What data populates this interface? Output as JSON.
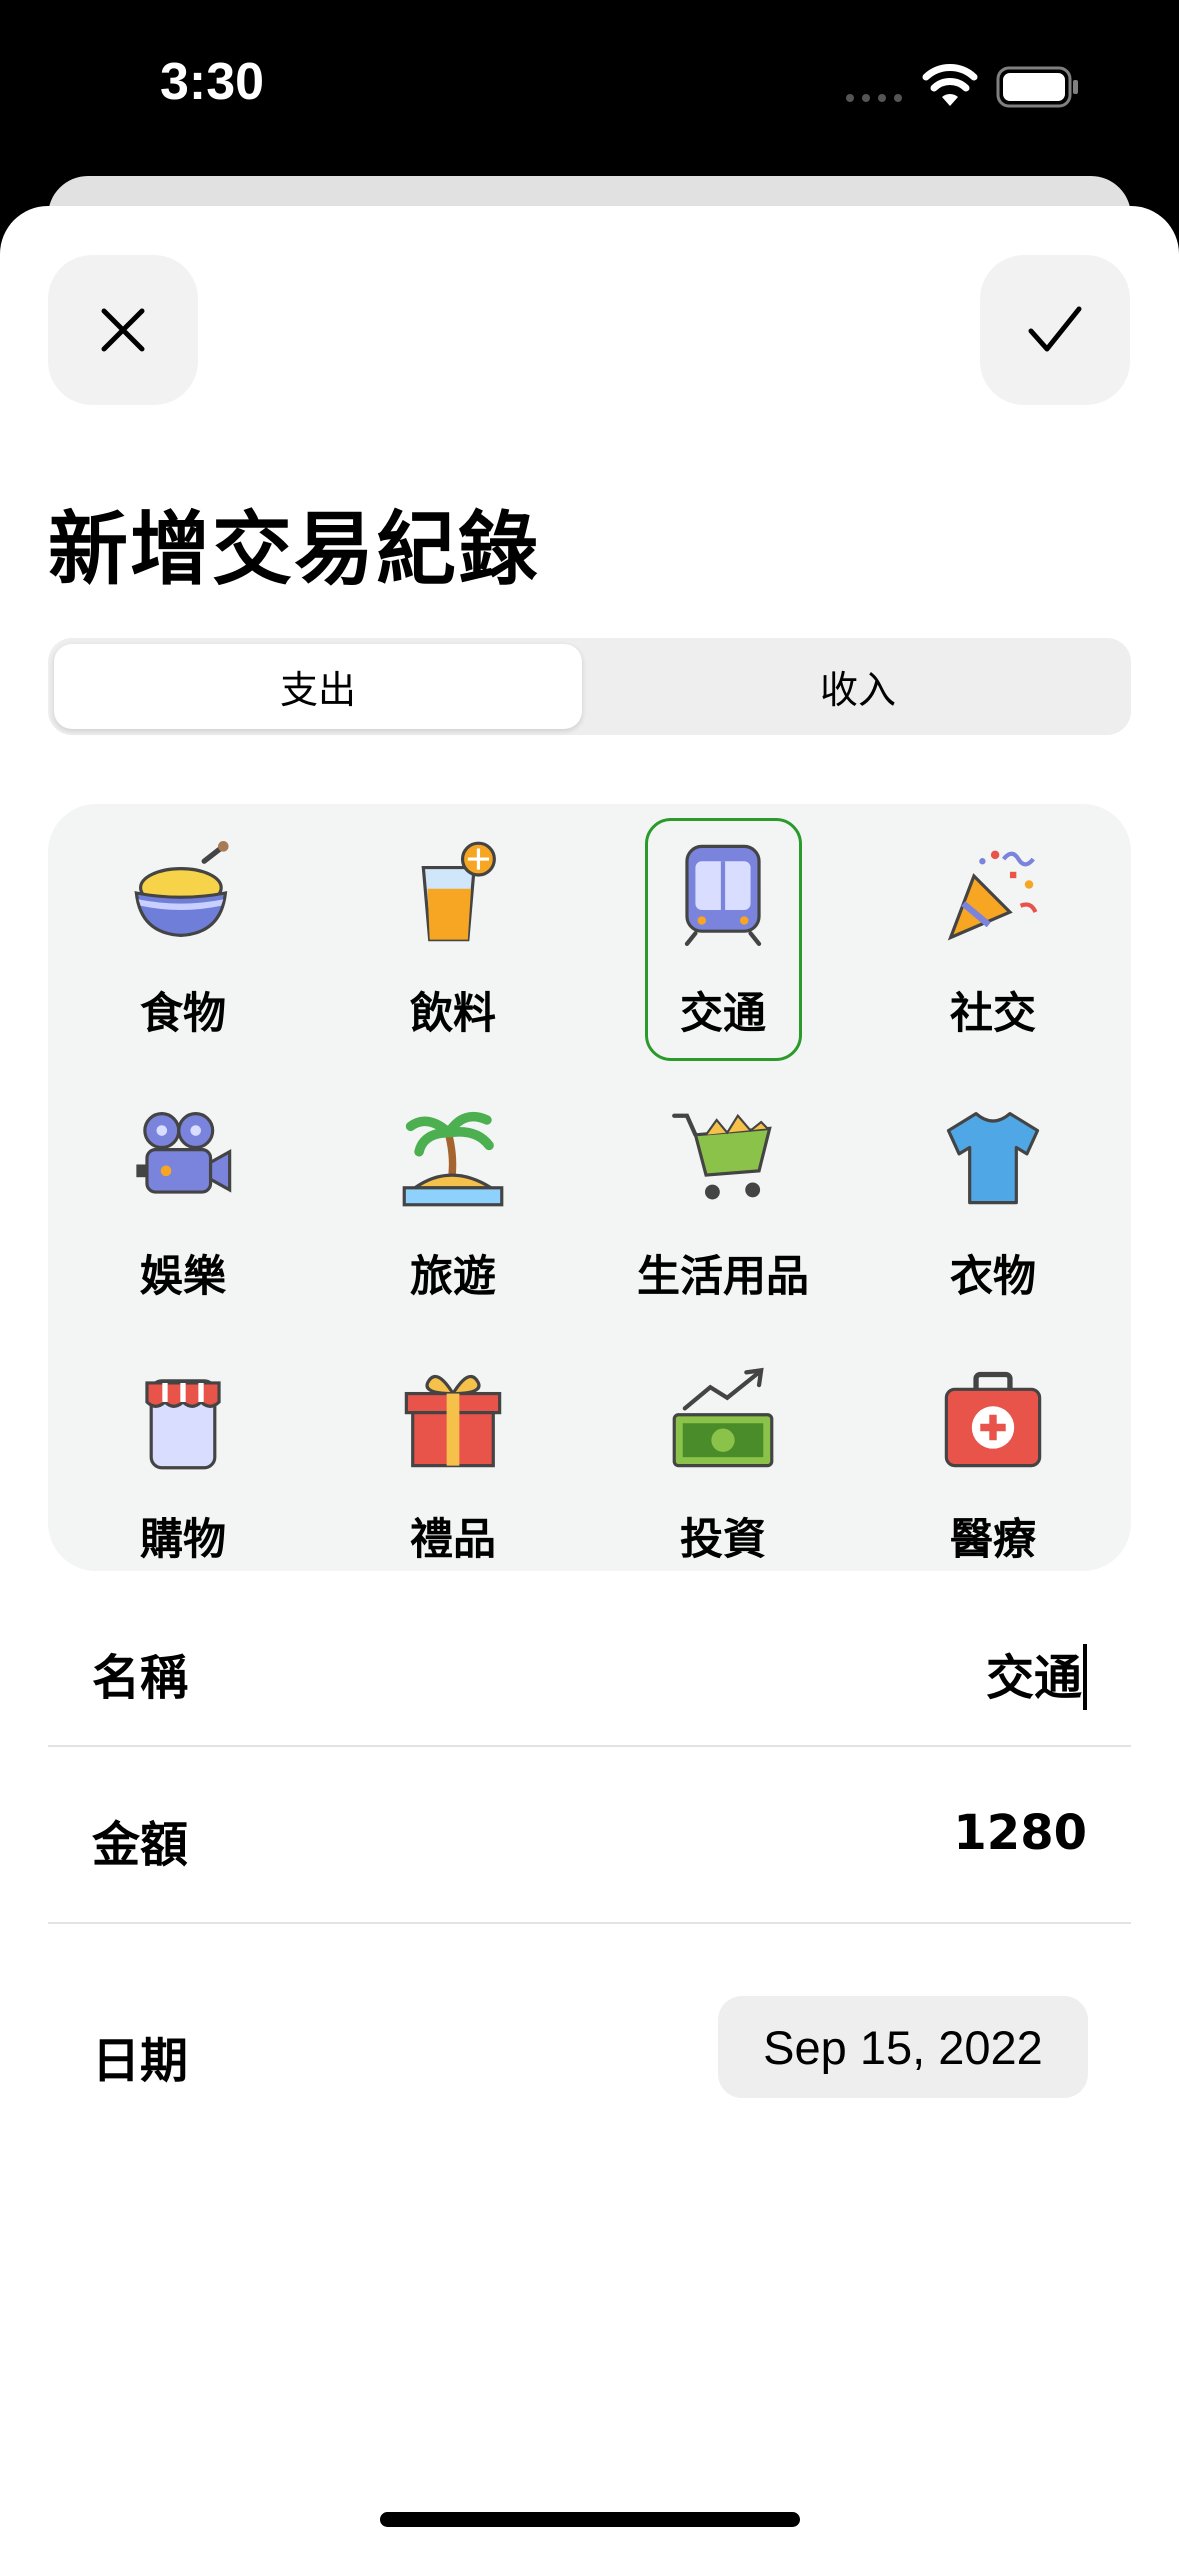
{
  "status_bar": {
    "time": "3:30",
    "icons": [
      "cellular-signal-icon",
      "wifi-icon",
      "battery-icon"
    ]
  },
  "nav": {
    "close_icon": "close-icon",
    "done_icon": "checkmark-icon"
  },
  "title": "新增交易紀錄",
  "segments": {
    "expense": "支出",
    "income": "收入",
    "selected": "支出"
  },
  "categories": [
    {
      "label": "食物",
      "icon": "rice-bowl-icon"
    },
    {
      "label": "飲料",
      "icon": "drink-glass-icon"
    },
    {
      "label": "交通",
      "icon": "train-icon"
    },
    {
      "label": "社交",
      "icon": "party-popper-icon"
    },
    {
      "label": "娛樂",
      "icon": "movie-camera-icon"
    },
    {
      "label": "旅遊",
      "icon": "island-palm-icon"
    },
    {
      "label": "生活用品",
      "icon": "shopping-cart-icon"
    },
    {
      "label": "衣物",
      "icon": "tshirt-icon"
    },
    {
      "label": "購物",
      "icon": "store-icon"
    },
    {
      "label": "禮品",
      "icon": "gift-icon"
    },
    {
      "label": "投資",
      "icon": "money-growth-icon"
    },
    {
      "label": "醫療",
      "icon": "first-aid-kit-icon"
    }
  ],
  "selected_category": "交通",
  "form": {
    "name_label": "名稱",
    "name_value": "交通",
    "amount_label": "金額",
    "amount_value": "1280",
    "date_label": "日期",
    "date_value": "Sep 15, 2022"
  },
  "colors": {
    "selection_border": "#2a9a2a",
    "panel_bg": "#f3f4f4",
    "control_bg": "#eeeeef"
  }
}
